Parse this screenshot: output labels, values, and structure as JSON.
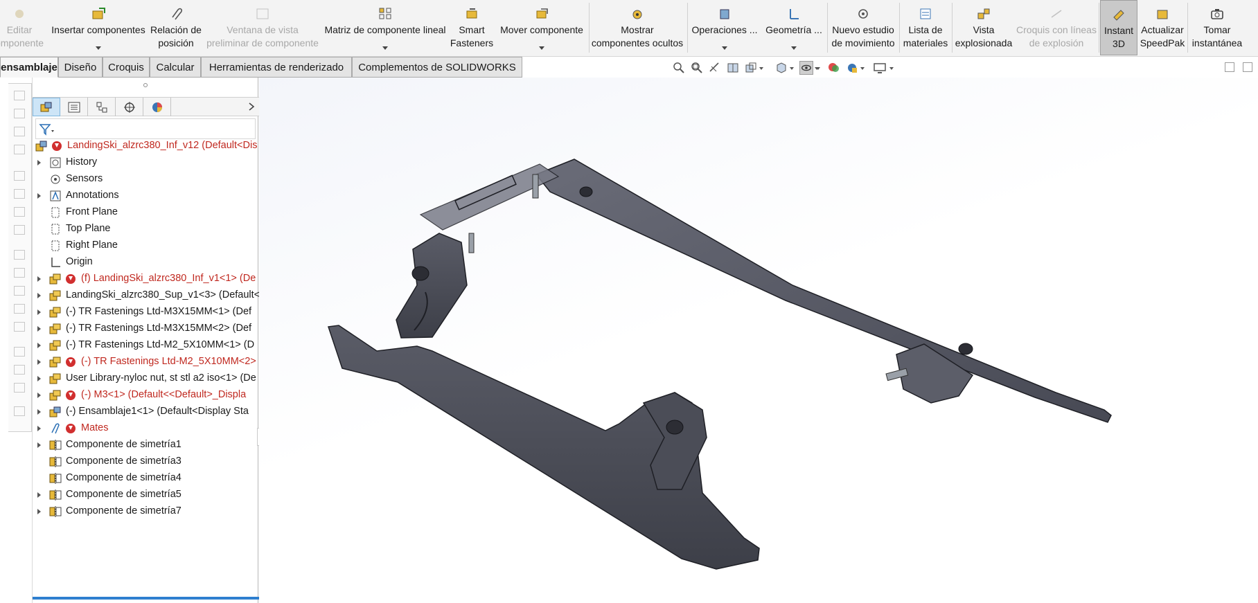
{
  "ribbon": {
    "buttons": [
      {
        "id": "edit-component",
        "label1": "Editar",
        "label2": "omponente",
        "disabled": true
      },
      {
        "id": "insert-components",
        "label1": "Insertar componentes",
        "label2": "",
        "caret": true
      },
      {
        "id": "mate",
        "label1": "Relación de",
        "label2": "posición"
      },
      {
        "id": "component-preview",
        "label1": "Ventana de vista",
        "label2": "preliminar de componente",
        "disabled": true
      },
      {
        "id": "linear-pattern",
        "label1": "Matriz de componente lineal",
        "label2": "",
        "caret": true
      },
      {
        "id": "smart-fasteners",
        "label1": "Smart",
        "label2": "Fasteners"
      },
      {
        "id": "move-component",
        "label1": "Mover componente",
        "label2": "",
        "caret": true
      },
      {
        "id": "show-hidden",
        "label1": "Mostrar",
        "label2": "componentes ocultos"
      },
      {
        "id": "assembly-features",
        "label1": "Operaciones ...",
        "label2": "",
        "caret": true
      },
      {
        "id": "reference-geometry",
        "label1": "Geometría ...",
        "label2": "",
        "caret": true
      },
      {
        "id": "new-motion-study",
        "label1": "Nuevo estudio",
        "label2": "de movimiento"
      },
      {
        "id": "bill-of-materials",
        "label1": "Lista de",
        "label2": "materiales"
      },
      {
        "id": "exploded-view",
        "label1": "Vista",
        "label2": "explosionada"
      },
      {
        "id": "explode-line-sketch",
        "label1": "Croquis con líneas",
        "label2": "de explosión",
        "disabled": true
      },
      {
        "id": "instant-3d",
        "label1": "Instant",
        "label2": "3D",
        "active": true
      },
      {
        "id": "update-speedpak",
        "label1": "Actualizar",
        "label2": "SpeedPak"
      },
      {
        "id": "take-snapshot",
        "label1": "Tomar",
        "label2": "instantánea"
      }
    ]
  },
  "tabs": [
    {
      "label": "ensamblaje",
      "active": true
    },
    {
      "label": "Diseño"
    },
    {
      "label": "Croquis"
    },
    {
      "label": "Calcular"
    },
    {
      "label": "Herramientas de renderizado"
    },
    {
      "label": "Complementos de SOLIDWORKS"
    }
  ],
  "tree": {
    "root": "LandingSki_alzrc380_Inf_v12  (Default<Dis",
    "items": [
      {
        "label": "History",
        "expand": true,
        "icon": "history-icon"
      },
      {
        "label": "Sensors",
        "icon": "sensor-icon"
      },
      {
        "label": "Annotations",
        "expand": true,
        "icon": "annotation-icon"
      },
      {
        "label": "Front Plane",
        "icon": "plane-icon"
      },
      {
        "label": "Top Plane",
        "icon": "plane-icon"
      },
      {
        "label": "Right Plane",
        "icon": "plane-icon"
      },
      {
        "label": "Origin",
        "icon": "origin-icon"
      },
      {
        "label": "(f) LandingSki_alzrc380_Inf_v1<1> (De",
        "expand": true,
        "icon": "part-icon",
        "error": true,
        "red": true
      },
      {
        "label": "LandingSki_alzrc380_Sup_v1<3> (Default<",
        "expand": true,
        "icon": "part-icon"
      },
      {
        "label": "(-) TR Fastenings Ltd-M3X15MM<1> (Def",
        "expand": true,
        "icon": "part-icon"
      },
      {
        "label": "(-) TR Fastenings Ltd-M3X15MM<2> (Def",
        "expand": true,
        "icon": "part-icon"
      },
      {
        "label": "(-) TR Fastenings Ltd-M2_5X10MM<1> (D",
        "expand": true,
        "icon": "part-icon"
      },
      {
        "label": "(-) TR Fastenings Ltd-M2_5X10MM<2>",
        "expand": true,
        "icon": "part-icon",
        "error": true,
        "red": true
      },
      {
        "label": "User Library-nyloc nut, st stl a2 iso<1> (De",
        "expand": true,
        "icon": "part-icon"
      },
      {
        "label": "(-) M3<1> (Default<<Default>_Displa",
        "expand": true,
        "icon": "part-icon",
        "error": true,
        "red": true
      },
      {
        "label": "(-) Ensamblaje1<1> (Default<Display Sta",
        "expand": true,
        "icon": "subassembly-icon"
      },
      {
        "label": "Mates",
        "expand": true,
        "icon": "mates-icon",
        "error": true,
        "red": true
      },
      {
        "label": "Componente de simetría1",
        "expand": true,
        "icon": "mirror-icon"
      },
      {
        "label": "Componente de simetría3",
        "icon": "mirror-icon"
      },
      {
        "label": "Componente de simetría4",
        "icon": "mirror-icon"
      },
      {
        "label": "Componente de simetría5",
        "expand": true,
        "icon": "mirror-icon"
      },
      {
        "label": "Componente de simetría7",
        "expand": true,
        "icon": "mirror-icon"
      }
    ]
  },
  "colors": {
    "accent": "#2e7fcf",
    "error": "#c0281f",
    "model": "#4a4c56",
    "model_dark": "#2c2d34"
  }
}
